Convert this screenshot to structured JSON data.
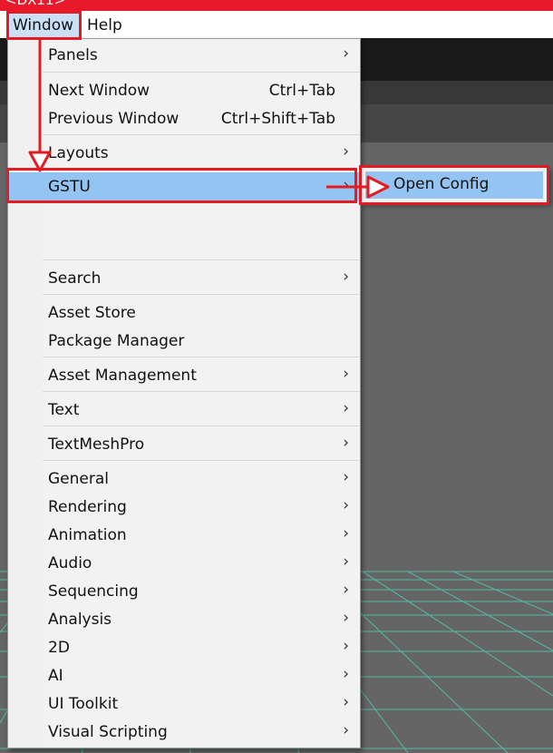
{
  "titlebar": {
    "text": "<DX11>"
  },
  "menubar": {
    "items": [
      {
        "label": "Window"
      },
      {
        "label": "Help"
      }
    ]
  },
  "window_menu": {
    "items": [
      {
        "label": "Panels",
        "submenu": true
      },
      {
        "label": "Next Window",
        "shortcut": "Ctrl+Tab"
      },
      {
        "label": "Previous Window",
        "shortcut": "Ctrl+Shift+Tab"
      },
      {
        "label": "Layouts",
        "submenu": true
      },
      {
        "label": "GSTU",
        "submenu": true,
        "highlighted": true
      },
      {
        "label": "Search",
        "submenu": true
      },
      {
        "label": "Asset Store"
      },
      {
        "label": "Package Manager"
      },
      {
        "label": "Asset Management",
        "submenu": true
      },
      {
        "label": "Text",
        "submenu": true
      },
      {
        "label": "TextMeshPro",
        "submenu": true
      },
      {
        "label": "General",
        "submenu": true
      },
      {
        "label": "Rendering",
        "submenu": true
      },
      {
        "label": "Animation",
        "submenu": true
      },
      {
        "label": "Audio",
        "submenu": true
      },
      {
        "label": "Sequencing",
        "submenu": true
      },
      {
        "label": "Analysis",
        "submenu": true
      },
      {
        "label": "2D",
        "submenu": true
      },
      {
        "label": "AI",
        "submenu": true
      },
      {
        "label": "UI Toolkit",
        "submenu": true
      },
      {
        "label": "Visual Scripting",
        "submenu": true
      }
    ],
    "arrow_glyph": "›"
  },
  "gstu_submenu": {
    "items": [
      {
        "label": "Open Config",
        "highlighted": true
      }
    ]
  },
  "colors": {
    "highlight": "#94c5f2",
    "annotation_red": "#e31b23",
    "grid_line": "#4fd8b8",
    "titlebar": "#e8192b"
  }
}
